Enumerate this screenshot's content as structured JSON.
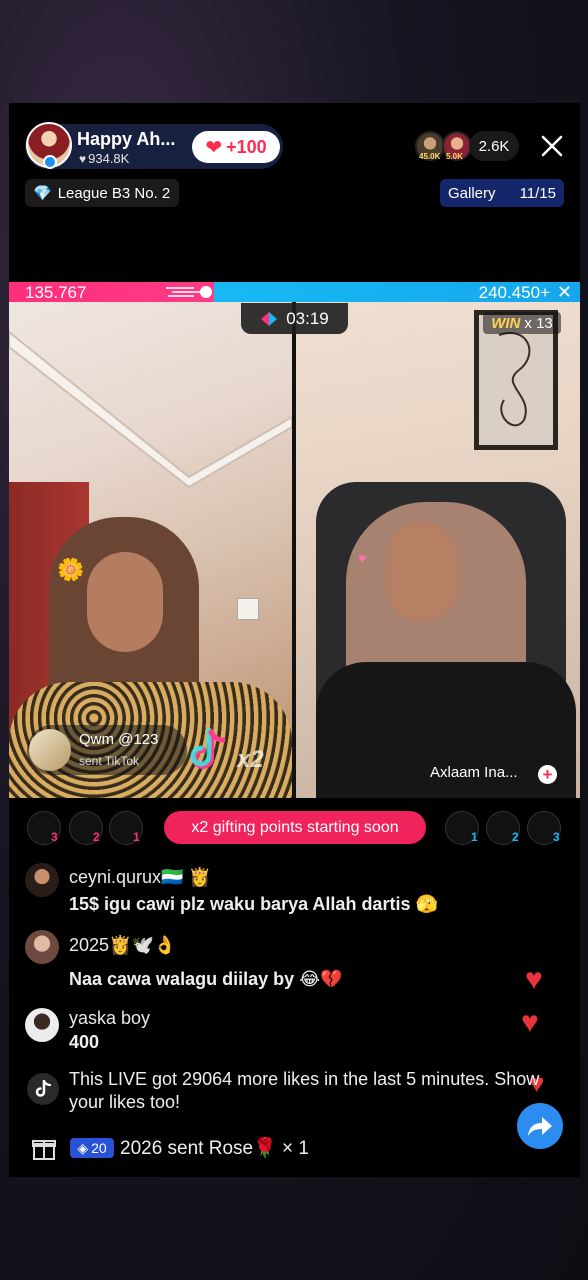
{
  "header": {
    "host_name": "Happy Ah...",
    "host_likes": "934.8K",
    "follow_label": "+100",
    "viewer_tags": [
      "45.0K",
      "5.0K"
    ],
    "viewer_count": "2.6K",
    "league": "League B3 No. 2",
    "gallery_label": "Gallery",
    "gallery_count": "11/15"
  },
  "battle": {
    "score_left": "135.767",
    "score_right": "240.450",
    "score_right_suffix": "+",
    "timer": "03:19",
    "win_label": "WIN",
    "win_count": "x 13",
    "left_color": "#ff2f7a",
    "right_color": "#17b9f4"
  },
  "gift_toast": {
    "name": "Qwm @123",
    "action": "sent TikTok",
    "multiplier": "x2"
  },
  "opponent": {
    "name": "Axlaam Ina..."
  },
  "supporters": {
    "left": [
      "3",
      "2",
      "1"
    ],
    "right": [
      "1",
      "2",
      "3"
    ],
    "banner": "x2 gifting points starting soon"
  },
  "chat": [
    {
      "user": "ceyni.qurux🇸🇱 👸",
      "message": "15$ igu cawi plz waku barya Allah dartis 🫣"
    },
    {
      "user": "2025👸🕊️👌",
      "message": "Naa cawa walagu diilay by 😂💔"
    },
    {
      "user": "yaska boy",
      "message": "400"
    }
  ],
  "system_message": "This LIVE got 29064 more likes in the last 5 minutes. Show your likes too!",
  "gift_row": {
    "level": "20",
    "text": "2026 sent Rose🌹 × 1"
  }
}
